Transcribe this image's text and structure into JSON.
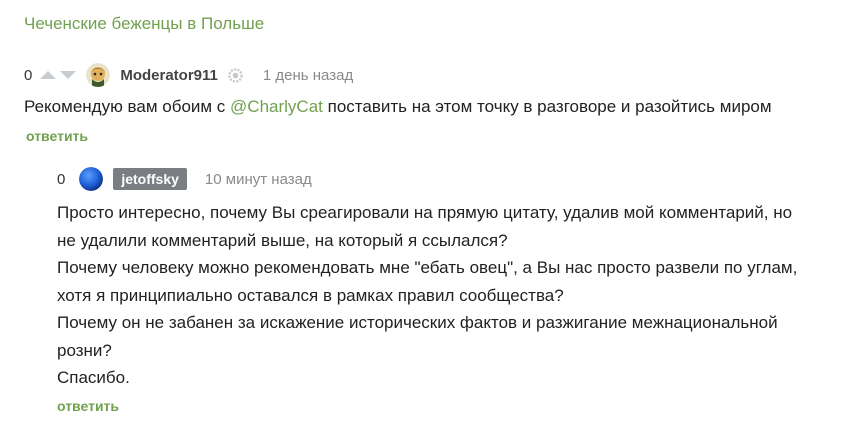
{
  "post": {
    "title": "Чеченские беженцы в Польше"
  },
  "comments": [
    {
      "rating": "0",
      "author": "Moderator911",
      "time": "1 день назад",
      "text_before": "Рекомендую вам обоим с ",
      "mention": "@CharlyCat",
      "text_after": " поставить на этом точку в разговоре и разойтись миром",
      "reply_label": "ответить"
    },
    {
      "rating": "0",
      "author": "jetoffsky",
      "time": "10 минут назад",
      "lines": [
        "Просто интересно, почему Вы среагировали на прямую цитату, удалив мой комментарий, но",
        "не удалили комментарий выше, на который я ссылался?",
        "Почему человеку можно рекомендовать мне \"ебать овец\", а Вы нас просто развели по углам,",
        "хотя я принципиально оставался в рамках правил сообщества?",
        "Почему он не забанен за искажение исторических фактов и разжигание межнациональной",
        "розни?",
        "Спасибо."
      ],
      "reply_label": "ответить"
    }
  ],
  "icons": {
    "upvote": "arrow-up-icon",
    "downvote": "arrow-down-icon",
    "moderator_badge": "gear-icon"
  },
  "colors": {
    "accent_green": "#71a14e",
    "vote_arrow": "#c7ccd1",
    "username_tag_bg": "#7a7d82",
    "meta_gray": "#8a8a8a"
  }
}
